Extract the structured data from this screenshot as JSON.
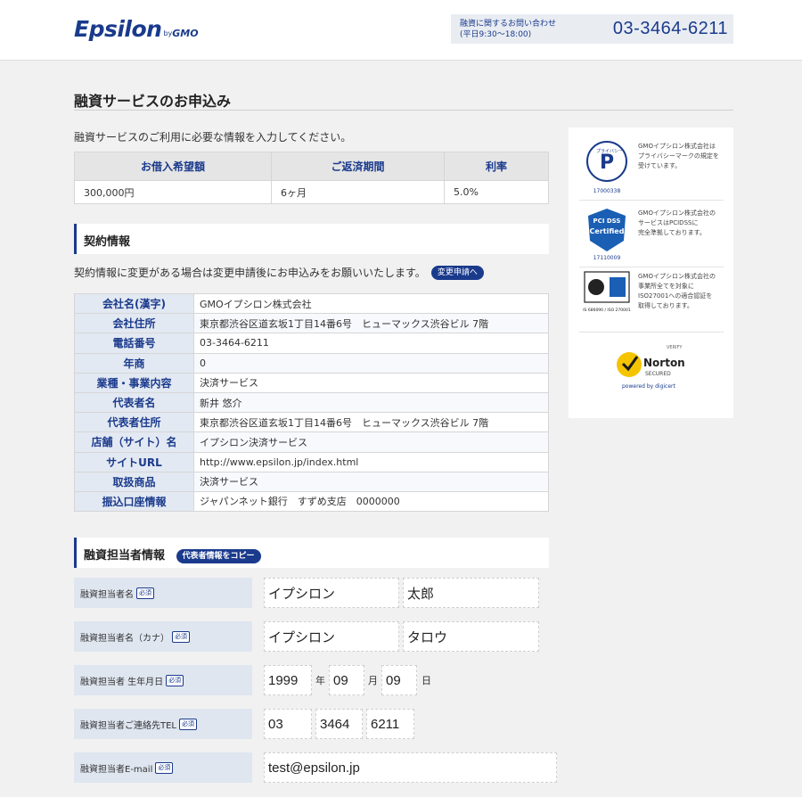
{
  "header": {
    "logo_main": "Epsilon",
    "logo_by": "by",
    "logo_gmo": "GMO",
    "contact_label_1": "融資に関するお問い合わせ",
    "contact_label_2": "(平日9:30〜18:00)",
    "contact_phone": "03-3464-6211"
  },
  "page": {
    "title": "融資サービスのお申込み",
    "intro": "融資サービスのご利用に必要な情報を入力してください。"
  },
  "summary": {
    "headers": [
      "お借入希望額",
      "ご返済期間",
      "利率"
    ],
    "values": [
      "300,000円",
      "6ヶ月",
      "5.0%"
    ]
  },
  "contract": {
    "section_title": "契約情報",
    "notice": "契約情報に変更がある場合は変更申請後にお申込みをお願いいたします。",
    "change_button": "変更申請へ",
    "rows": [
      {
        "label": "会社名(漢字)",
        "value": "GMOイプシロン株式会社"
      },
      {
        "label": "会社住所",
        "value": "東京都渋谷区道玄坂1丁目14番6号　ヒューマックス渋谷ビル 7階"
      },
      {
        "label": "電話番号",
        "value": "03-3464-6211"
      },
      {
        "label": "年商",
        "value": "0"
      },
      {
        "label": "業種・事業内容",
        "value": "決済サービス"
      },
      {
        "label": "代表者名",
        "value": "新井 悠介"
      },
      {
        "label": "代表者住所",
        "value": "東京都渋谷区道玄坂1丁目14番6号　ヒューマックス渋谷ビル 7階"
      },
      {
        "label": "店舗（サイト）名",
        "value": "イプシロン決済サービス"
      },
      {
        "label": "サイトURL",
        "value": "http://www.epsilon.jp/index.html"
      },
      {
        "label": "取扱商品",
        "value": "決済サービス"
      },
      {
        "label": "振込口座情報",
        "value": "ジャパンネット銀行　すずめ支店　0000000"
      }
    ]
  },
  "officer": {
    "section_title": "融資担当者情報",
    "copy_button": "代表者情報をコピー",
    "required": "必須",
    "name_label": "融資担当者名",
    "name_last": "イプシロン",
    "name_first": "太郎",
    "kana_label": "融資担当者名（カナ）",
    "kana_last": "イプシロン",
    "kana_first": "タロウ",
    "birth_label": "融資担当者 生年月日",
    "birth_year": "1999",
    "birth_month": "09",
    "birth_day": "09",
    "unit_year": "年",
    "unit_month": "月",
    "unit_day": "日",
    "tel_label": "融資担当者ご連絡先TEL",
    "tel_1": "03",
    "tel_2": "3464",
    "tel_3": "6211",
    "email_label": "融資担当者E-mail",
    "email": "test@epsilon.jp"
  },
  "sidebar": {
    "privacy_text": "GMOイプシロン株式会社は\nプライバシーマークの規定を\n受けています。",
    "privacy_code": "17000338",
    "privacy_mark": "プライバシー",
    "pci_text": "GMOイプシロン株式会社の\nサービスはPCIDSSに\n完全準拠しております。",
    "pci_top": "PCI DSS",
    "pci_mid": "Certified",
    "pci_code": "17110009",
    "iso_text": "GMOイプシロン株式会社の\n事業所全てを対象に\nISO27001への適合認証を\n取得しております。",
    "iso_code": "IS 686090 / ISO 270001",
    "norton_verify": "VERIFY",
    "norton_name": "Norton",
    "norton_secured": "SECURED",
    "norton_powered": "powered by digicert"
  },
  "colors": {
    "brand": "#1a3a8c",
    "background": "#f1f1f1"
  }
}
